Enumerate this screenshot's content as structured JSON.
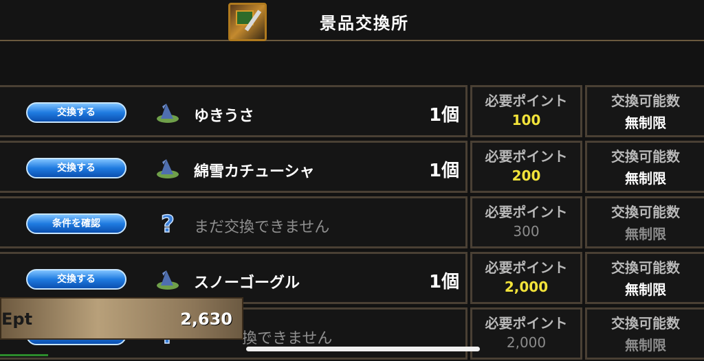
{
  "header": {
    "title": "景品交換所",
    "icon": "treasure-chest-sword-icon"
  },
  "column_labels": {
    "points": "必要ポイント",
    "limit": "交換可能数"
  },
  "rows": [
    {
      "button": "交換する",
      "icon": "wizard-hat-icon",
      "name": "ゆきうさ",
      "qty": "1個",
      "points": "100",
      "limit": "無制限",
      "available": true
    },
    {
      "button": "交換する",
      "icon": "wizard-hat-icon",
      "name": "綿雪カチューシャ",
      "qty": "1個",
      "points": "200",
      "limit": "無制限",
      "available": true
    },
    {
      "button": "条件を確認",
      "icon": "question-mark-icon",
      "name": "まだ交換できません",
      "qty": "",
      "points": "300",
      "limit": "無制限",
      "available": false
    },
    {
      "button": "交換する",
      "icon": "wizard-hat-icon",
      "name": "スノーゴーグル",
      "qty": "1個",
      "points": "2,000",
      "limit": "無制限",
      "available": true
    },
    {
      "button": "",
      "icon": "question-mark-icon",
      "name": "換できません",
      "qty": "",
      "points": "2,000",
      "limit": "無制限",
      "available": false
    }
  ],
  "balance": {
    "label": "Ept",
    "value": "2,630"
  },
  "colors": {
    "points_highlight": "#f2e33a",
    "button_blue": "#1f7be0",
    "frame": "#4a4034"
  }
}
